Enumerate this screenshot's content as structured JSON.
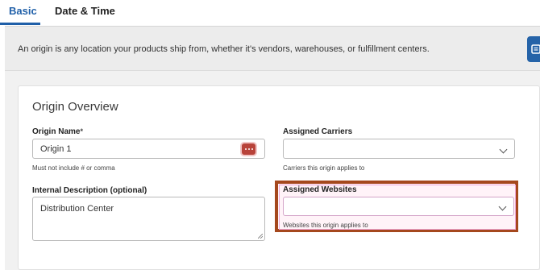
{
  "tabs": {
    "basic": "Basic",
    "date_time": "Date & Time"
  },
  "banner": {
    "text": "An origin is any location your products ship from, whether it's vendors, warehouses, or fulfillment centers."
  },
  "section": {
    "title": "Origin Overview"
  },
  "fields": {
    "origin_name": {
      "label": "Origin Name",
      "required_mark": "*",
      "value": "Origin 1",
      "help": "Must not include # or comma"
    },
    "assigned_carriers": {
      "label": "Assigned Carriers",
      "value": "",
      "help": "Carriers this origin applies to"
    },
    "internal_description": {
      "label": "Internal Description (optional)",
      "value": "Distribution Center"
    },
    "assigned_websites": {
      "label": "Assigned Websites",
      "value": "",
      "help": "Websites this origin applies to"
    }
  },
  "colors": {
    "accent": "#1f5fa8",
    "highlight_border": "#a5481d"
  }
}
